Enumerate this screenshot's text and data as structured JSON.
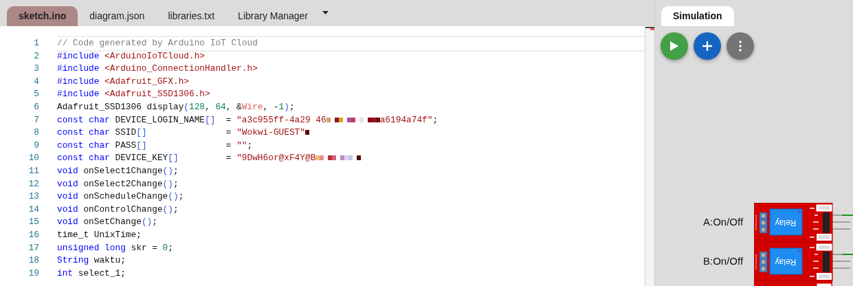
{
  "tabs": [
    {
      "label": "sketch.ino",
      "selected": true
    },
    {
      "label": "diagram.json",
      "selected": false
    },
    {
      "label": "libraries.txt",
      "selected": false
    },
    {
      "label": "Library Manager",
      "selected": false
    }
  ],
  "editor": {
    "lines": [
      {
        "number": "1",
        "current": true,
        "tokens": [
          {
            "kind": "comment",
            "text": "// Code generated by Arduino IoT Cloud"
          }
        ]
      },
      {
        "number": "2",
        "current": false,
        "tokens": [
          {
            "kind": "keyword",
            "text": "#include"
          },
          {
            "kind": "string",
            "text": " <ArduinoIoTCloud.h>"
          }
        ]
      },
      {
        "number": "3",
        "current": false,
        "tokens": [
          {
            "kind": "keyword",
            "text": "#include"
          },
          {
            "kind": "string",
            "text": " <Arduino_ConnectionHandler.h>"
          }
        ]
      },
      {
        "number": "4",
        "current": false,
        "tokens": [
          {
            "kind": "keyword",
            "text": "#include"
          },
          {
            "kind": "string",
            "text": " <Adafruit_GFX.h>"
          }
        ]
      },
      {
        "number": "5",
        "current": false,
        "tokens": [
          {
            "kind": "keyword",
            "text": "#include"
          },
          {
            "kind": "string",
            "text": " <Adafruit_SSD1306.h>"
          }
        ]
      },
      {
        "number": "6",
        "current": false,
        "tokens": [
          {
            "kind": "plain",
            "text": "Adafruit_SSD1306 display"
          },
          {
            "kind": "bracket",
            "text": "("
          },
          {
            "kind": "number",
            "text": "128"
          },
          {
            "kind": "plain",
            "text": ", "
          },
          {
            "kind": "number",
            "text": "64"
          },
          {
            "kind": "plain",
            "text": ", &"
          },
          {
            "kind": "variable",
            "text": "Wire"
          },
          {
            "kind": "plain",
            "text": ", -"
          },
          {
            "kind": "number",
            "text": "1"
          },
          {
            "kind": "bracket",
            "text": ")"
          },
          {
            "kind": "plain",
            "text": ";"
          }
        ]
      },
      {
        "number": "7",
        "current": false,
        "tokens": [
          {
            "kind": "keyword",
            "text": "const char"
          },
          {
            "kind": "plain",
            "text": " DEVICE_LOGIN_NAME"
          },
          {
            "kind": "bracket",
            "text": "[]"
          },
          {
            "kind": "plain",
            "text": "  = "
          },
          {
            "kind": "string",
            "text": "\"a3c955ff-4a29 46"
          },
          {
            "kind": "redacted-long"
          },
          {
            "kind": "string",
            "text": "a6194a74f\""
          },
          {
            "kind": "plain",
            "text": ";"
          }
        ]
      },
      {
        "number": "8",
        "current": false,
        "tokens": [
          {
            "kind": "keyword",
            "text": "const char"
          },
          {
            "kind": "plain",
            "text": " SSID"
          },
          {
            "kind": "bracket",
            "text": "[]"
          },
          {
            "kind": "plain",
            "text": "               = "
          },
          {
            "kind": "string",
            "text": "\"Wokwi-GUEST\""
          },
          {
            "kind": "redacted-short"
          }
        ]
      },
      {
        "number": "9",
        "current": false,
        "tokens": [
          {
            "kind": "keyword",
            "text": "const char"
          },
          {
            "kind": "plain",
            "text": " PASS"
          },
          {
            "kind": "bracket",
            "text": "[]"
          },
          {
            "kind": "plain",
            "text": "               = "
          },
          {
            "kind": "string",
            "text": "\"\""
          },
          {
            "kind": "plain",
            "text": ";"
          }
        ]
      },
      {
        "number": "10",
        "current": false,
        "tokens": [
          {
            "kind": "keyword",
            "text": "const char"
          },
          {
            "kind": "plain",
            "text": " DEVICE_KEY"
          },
          {
            "kind": "bracket",
            "text": "[]"
          },
          {
            "kind": "plain",
            "text": "         = "
          },
          {
            "kind": "string",
            "text": "\"9DwH6or@xF4Y@B"
          },
          {
            "kind": "redacted-medium"
          }
        ]
      },
      {
        "number": "11",
        "current": false,
        "tokens": [
          {
            "kind": "keyword",
            "text": "void"
          },
          {
            "kind": "plain",
            "text": " onSelect1Change"
          },
          {
            "kind": "bracket",
            "text": "()"
          },
          {
            "kind": "plain",
            "text": ";"
          }
        ]
      },
      {
        "number": "12",
        "current": false,
        "tokens": [
          {
            "kind": "keyword",
            "text": "void"
          },
          {
            "kind": "plain",
            "text": " onSelect2Change"
          },
          {
            "kind": "bracket",
            "text": "()"
          },
          {
            "kind": "plain",
            "text": ";"
          }
        ]
      },
      {
        "number": "13",
        "current": false,
        "tokens": [
          {
            "kind": "keyword",
            "text": "void"
          },
          {
            "kind": "plain",
            "text": " onScheduleChange"
          },
          {
            "kind": "bracket",
            "text": "()"
          },
          {
            "kind": "plain",
            "text": ";"
          }
        ]
      },
      {
        "number": "14",
        "current": false,
        "tokens": [
          {
            "kind": "keyword",
            "text": "void"
          },
          {
            "kind": "plain",
            "text": " onControlChange"
          },
          {
            "kind": "bracket",
            "text": "()"
          },
          {
            "kind": "plain",
            "text": ";"
          }
        ]
      },
      {
        "number": "15",
        "current": false,
        "tokens": [
          {
            "kind": "keyword",
            "text": "void"
          },
          {
            "kind": "plain",
            "text": " onSetChange"
          },
          {
            "kind": "bracket",
            "text": "()"
          },
          {
            "kind": "plain",
            "text": ";"
          }
        ]
      },
      {
        "number": "16",
        "current": false,
        "tokens": [
          {
            "kind": "plain",
            "text": "time_t UnixTime;"
          }
        ]
      },
      {
        "number": "17",
        "current": false,
        "tokens": [
          {
            "kind": "keyword",
            "text": "unsigned long"
          },
          {
            "kind": "plain",
            "text": " skr = "
          },
          {
            "kind": "number",
            "text": "0"
          },
          {
            "kind": "plain",
            "text": ";"
          }
        ]
      },
      {
        "number": "18",
        "current": false,
        "tokens": [
          {
            "kind": "keyword",
            "text": "String"
          },
          {
            "kind": "plain",
            "text": " waktu;"
          }
        ]
      },
      {
        "number": "19",
        "current": false,
        "tokens": [
          {
            "kind": "keyword",
            "text": "int"
          },
          {
            "kind": "plain",
            "text": " select_1;"
          }
        ]
      }
    ]
  },
  "simulation": {
    "tab": {
      "label": "Simulation",
      "selected": true
    },
    "buttons": [
      {
        "kind": "play",
        "color": "#43a047"
      },
      {
        "kind": "add",
        "color": "#1565c0"
      },
      {
        "kind": "more",
        "color": "#757575"
      }
    ],
    "parts": [
      {
        "kind": "relay",
        "label": "A:On/Off",
        "title": "Relay"
      },
      {
        "kind": "relay",
        "label": "B:On/Off",
        "title": "Relay"
      },
      {
        "kind": "relay-partial"
      }
    ]
  }
}
